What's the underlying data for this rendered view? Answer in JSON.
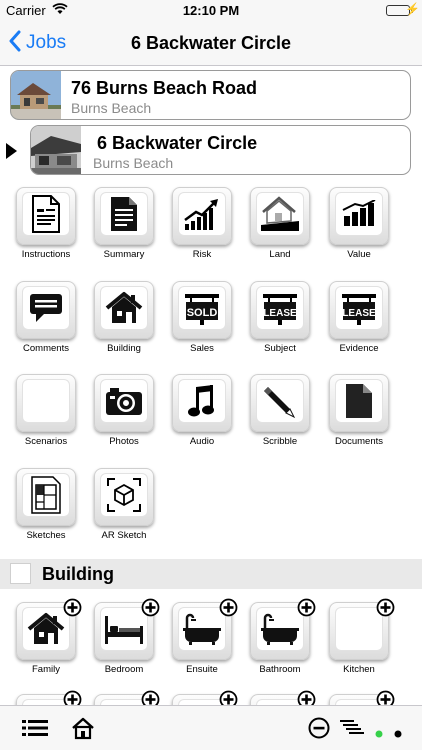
{
  "status": {
    "carrier": "Carrier",
    "time": "12:10 PM"
  },
  "nav": {
    "back_label": "Jobs",
    "title": "6 Backwater Circle"
  },
  "jobs": [
    {
      "name": "76 Burns Beach Road",
      "suburb": "Burns Beach"
    },
    {
      "name": "6 Backwater Circle",
      "suburb": "Burns Beach"
    }
  ],
  "job_tiles": [
    {
      "label": "Instructions",
      "icon": "document-icon"
    },
    {
      "label": "Summary",
      "icon": "summary-doc-icon"
    },
    {
      "label": "Risk",
      "icon": "rising-chart-icon"
    },
    {
      "label": "Land",
      "icon": "house-land-icon"
    },
    {
      "label": "Value",
      "icon": "bar-chart-icon"
    },
    {
      "label": "Comments",
      "icon": "speech-bubble-icon"
    },
    {
      "label": "Building",
      "icon": "house-icon"
    },
    {
      "label": "Sales",
      "icon": "sold-sign-icon",
      "sign": "SOLD"
    },
    {
      "label": "Subject",
      "icon": "lease-sign-icon",
      "sign": "LEASE"
    },
    {
      "label": "Evidence",
      "icon": "lease-sign-icon",
      "sign": "LEASE"
    },
    {
      "label": "Scenarios",
      "icon": "blank-icon"
    },
    {
      "label": "Photos",
      "icon": "camera-icon"
    },
    {
      "label": "Audio",
      "icon": "music-note-icon"
    },
    {
      "label": "Scribble",
      "icon": "pen-icon"
    },
    {
      "label": "Documents",
      "icon": "file-icon"
    },
    {
      "label": "Sketches",
      "icon": "floor-plan-icon"
    },
    {
      "label": "AR Sketch",
      "icon": "ar-cube-icon"
    }
  ],
  "section": {
    "title": "Building"
  },
  "building_tiles": [
    {
      "label": "Family",
      "icon": "house-icon"
    },
    {
      "label": "Bedroom",
      "icon": "bed-icon"
    },
    {
      "label": "Ensuite",
      "icon": "bathtub-icon"
    },
    {
      "label": "Bathroom",
      "icon": "bathtub-icon"
    },
    {
      "label": "Kitchen",
      "icon": "blank-icon"
    }
  ],
  "colors": {
    "accent": "#1a7cf5",
    "battery": "#4cd964",
    "indicator_green": "#36d14a"
  }
}
